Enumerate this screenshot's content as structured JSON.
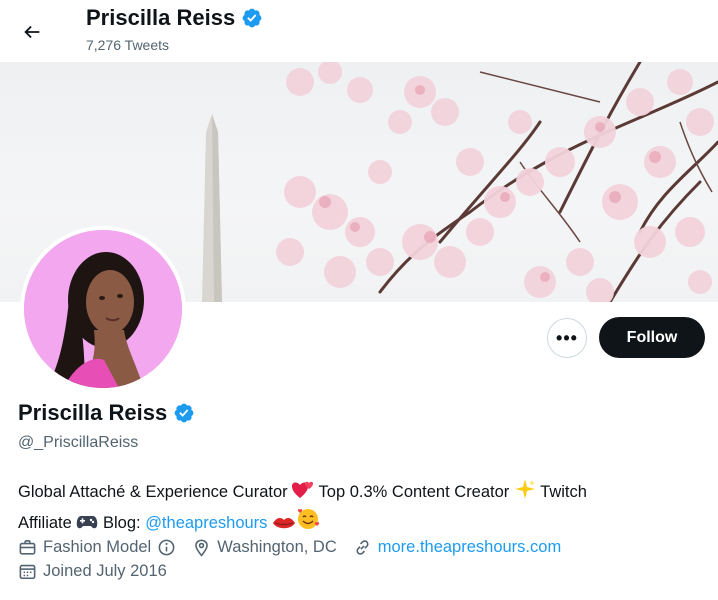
{
  "header": {
    "name": "Priscilla Reiss",
    "tweet_count": "7,276 Tweets"
  },
  "profile": {
    "name": "Priscilla Reiss",
    "handle": "@_PriscillaReiss",
    "verified_color": "#1d9bf0",
    "avatar_bg": "#f2a7ef"
  },
  "actions": {
    "more_label": "•••",
    "follow_label": "Follow"
  },
  "bio": {
    "part1": "Global Attaché & Experience Curator ",
    "part2": " Top 0.3% Content Creator ",
    "part3": " Twitch",
    "part4": "Affiliate ",
    "part5": " Blog: ",
    "link": "@theapreshours",
    "emojis": [
      "two-hearts-icon",
      "sparkles-icon",
      "game-controller-icon",
      "lips-icon",
      "smiling-face-with-hearts-icon"
    ]
  },
  "meta": {
    "category": "Fashion Model",
    "location": "Washington, DC",
    "website": "more.theapreshours.com",
    "joined": "Joined July 2016"
  },
  "colors": {
    "text": "#0f1419",
    "secondary": "#536471",
    "link": "#1d9bf0",
    "follow_bg": "#0f1419"
  }
}
